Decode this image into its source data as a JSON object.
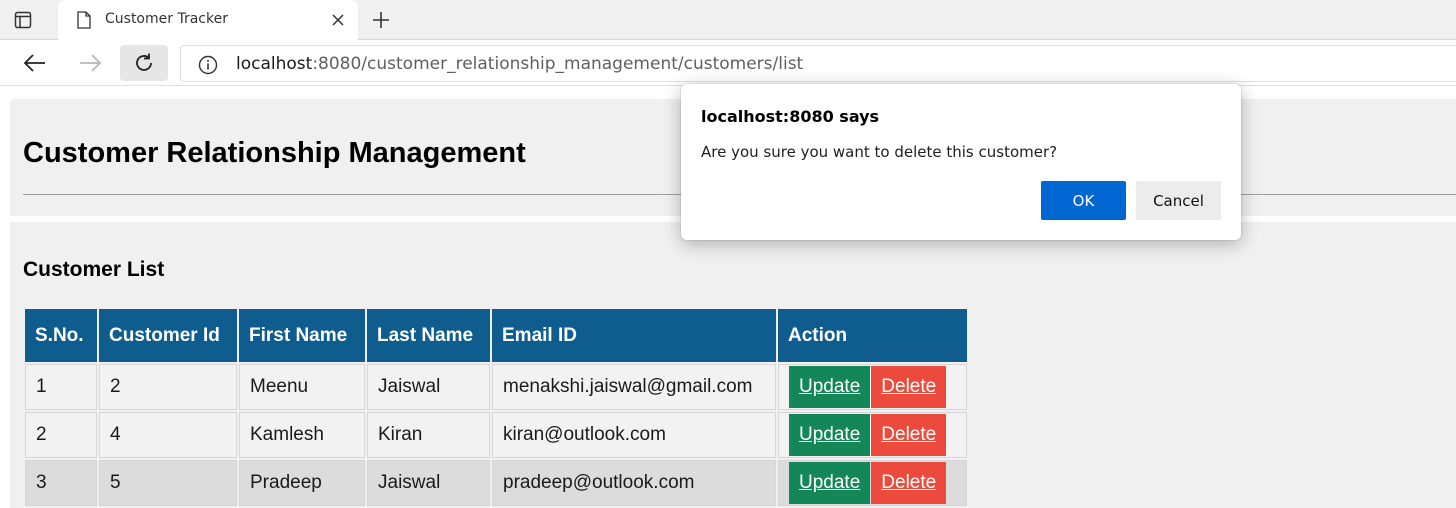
{
  "browser": {
    "tab_title": "Customer Tracker",
    "url_host": "localhost",
    "url_path": ":8080/customer_relationship_management/customers/list"
  },
  "page": {
    "title": "Customer Relationship Management",
    "section_title": "Customer List"
  },
  "table": {
    "headers": [
      "S.No.",
      "Customer Id",
      "First Name",
      "Last Name",
      "Email ID",
      "Action"
    ],
    "rows": [
      {
        "sno": "1",
        "id": "2",
        "first": "Meenu",
        "last": "Jaiswal",
        "email": "menakshi.jaiswal@gmail.com"
      },
      {
        "sno": "2",
        "id": "4",
        "first": "Kamlesh",
        "last": "Kiran",
        "email": "kiran@outlook.com"
      },
      {
        "sno": "3",
        "id": "5",
        "first": "Pradeep",
        "last": "Jaiswal",
        "email": "pradeep@outlook.com"
      }
    ],
    "update_label": "Update ",
    "delete_label": "Delete"
  },
  "dialog": {
    "title": "localhost:8080 says",
    "message": "Are you sure you want to delete this customer?",
    "ok_label": "OK",
    "cancel_label": "Cancel"
  },
  "colors": {
    "header_bg": "#0f5d8e",
    "update_btn": "#138757",
    "delete_btn": "#ec4a3c",
    "ok_btn": "#0067d2"
  },
  "icons": [
    "tab-actions-icon",
    "page-icon",
    "close-icon",
    "plus-icon",
    "back-arrow-icon",
    "forward-arrow-icon",
    "reload-icon",
    "info-icon"
  ]
}
